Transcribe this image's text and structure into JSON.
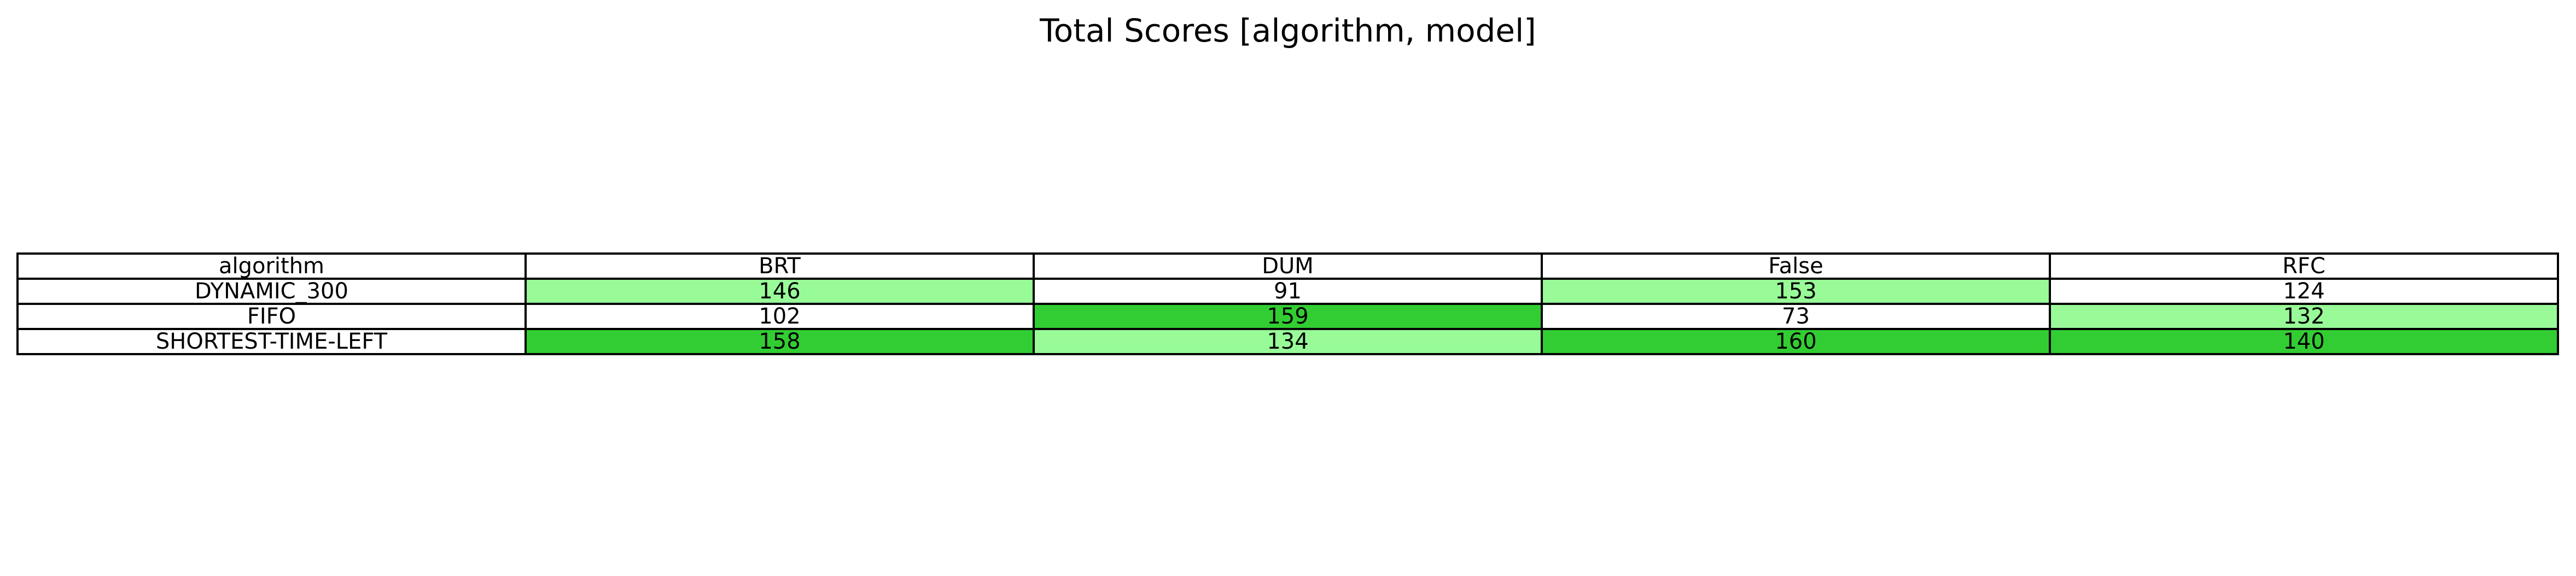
{
  "chart_data": {
    "type": "table",
    "title": "Total Scores [algorithm, model]",
    "row_header": "algorithm",
    "columns": [
      "BRT",
      "DUM",
      "False",
      "RFC"
    ],
    "rows": [
      {
        "label": "DYNAMIC_300",
        "values": [
          146,
          91,
          153,
          124
        ]
      },
      {
        "label": "FIFO",
        "values": [
          102,
          159,
          73,
          132
        ]
      },
      {
        "label": "SHORTEST-TIME-LEFT",
        "values": [
          158,
          134,
          160,
          140
        ]
      }
    ],
    "highlight_colors": {
      "rank_1": "#32cd32",
      "rank_2": "#98fb98",
      "default": "#ffffff"
    }
  }
}
